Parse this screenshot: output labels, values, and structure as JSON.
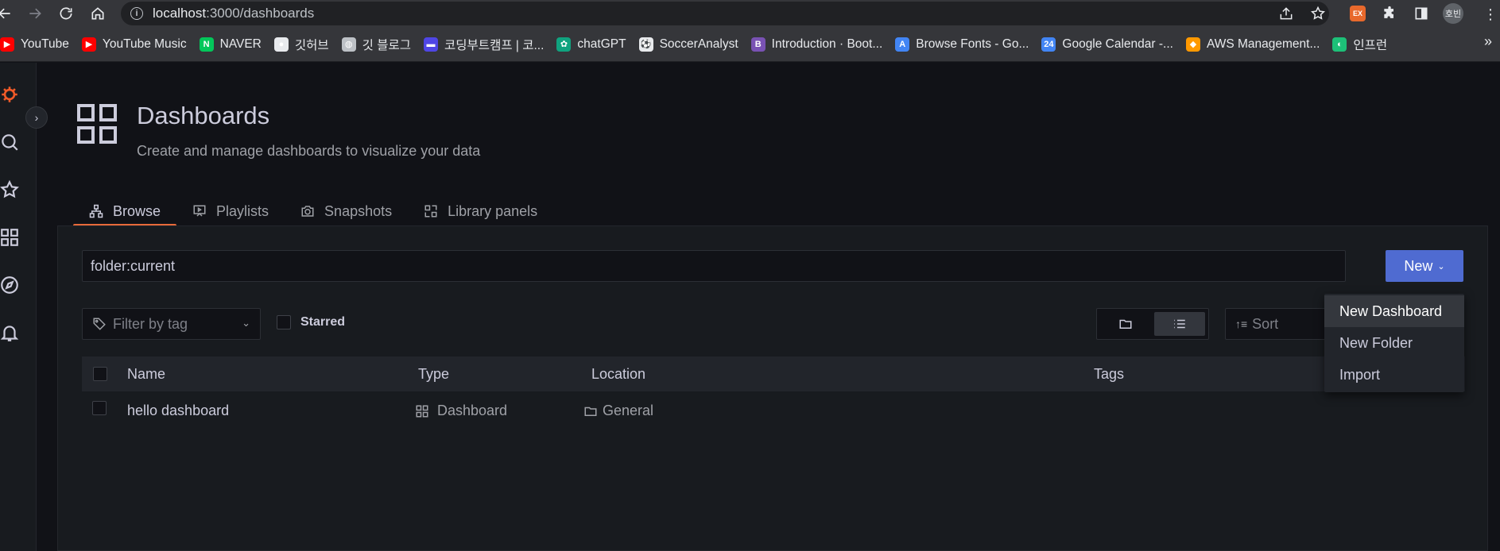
{
  "browser": {
    "url_host": "localhost",
    "url_path": ":3000/dashboards",
    "profile_label": "호빈",
    "ext_label": "EX",
    "bookmarks": [
      {
        "label": "YouTube",
        "icon": "youtube-icon",
        "color": "#ff0000"
      },
      {
        "label": "YouTube Music",
        "icon": "youtube-music-icon",
        "color": "#ff0000"
      },
      {
        "label": "NAVER",
        "icon": "naver-icon",
        "color": "#03c75a"
      },
      {
        "label": "깃허브",
        "icon": "github-icon",
        "color": "#e8eaed"
      },
      {
        "label": "깃 블로그",
        "icon": "globe-icon",
        "color": "#bdc1c6"
      },
      {
        "label": "코딩부트캠프 | 코...",
        "icon": "bootcamp-icon",
        "color": "#4f46e5"
      },
      {
        "label": "chatGPT",
        "icon": "chatgpt-icon",
        "color": "#10a37f"
      },
      {
        "label": "SoccerAnalyst",
        "icon": "soccer-icon",
        "color": "#e8eaed"
      },
      {
        "label": "Introduction · Boot...",
        "icon": "bootstrap-icon",
        "color": "#7952b3"
      },
      {
        "label": "Browse Fonts - Go...",
        "icon": "google-fonts-icon",
        "color": "#4285f4"
      },
      {
        "label": "Google Calendar -...",
        "icon": "google-calendar-icon",
        "color": "#4285f4"
      },
      {
        "label": "AWS Management...",
        "icon": "aws-icon",
        "color": "#ff9900"
      },
      {
        "label": "인프런",
        "icon": "inflearn-icon",
        "color": "#1dc078"
      }
    ]
  },
  "page": {
    "title": "Dashboards",
    "subtitle": "Create and manage dashboards to visualize your data"
  },
  "tabs": [
    {
      "label": "Browse",
      "icon": "browse-icon",
      "active": true
    },
    {
      "label": "Playlists",
      "icon": "playlist-icon",
      "active": false
    },
    {
      "label": "Snapshots",
      "icon": "camera-icon",
      "active": false
    },
    {
      "label": "Library panels",
      "icon": "library-panels-icon",
      "active": false
    }
  ],
  "search": {
    "value": "folder:current"
  },
  "new_button": {
    "label": "New"
  },
  "filters": {
    "tag_placeholder": "Filter by tag",
    "starred_label": "Starred",
    "sort_placeholder": "Sort"
  },
  "table": {
    "columns": [
      "Name",
      "Type",
      "Location",
      "Tags"
    ],
    "rows": [
      {
        "name": "hello dashboard",
        "type": "Dashboard",
        "location": "General",
        "tags": ""
      }
    ]
  },
  "dropdown": {
    "items": [
      "New Dashboard",
      "New Folder",
      "Import"
    ],
    "hovered": "New Dashboard"
  },
  "colors": {
    "accent_blue": "#4f6bd1",
    "tab_underline": "#e86a3a",
    "grafana_logo": "#f05a28"
  }
}
